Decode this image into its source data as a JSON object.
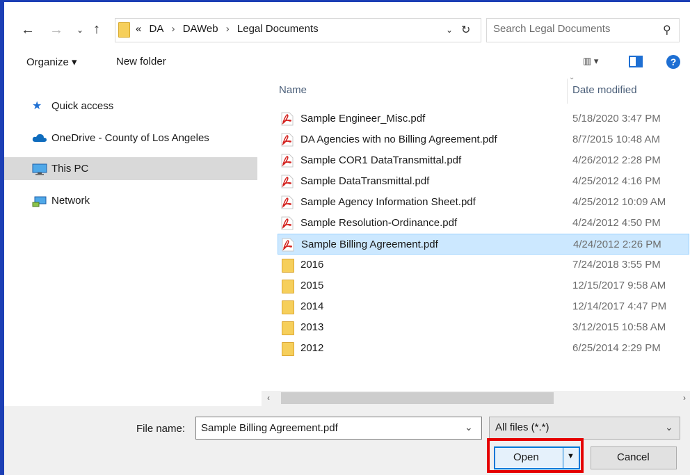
{
  "address_bar": {
    "overflow": "«",
    "crumbs": [
      "DA",
      "DAWeb",
      "Legal Documents"
    ],
    "separator": "›"
  },
  "search": {
    "placeholder": "Search Legal Documents"
  },
  "toolbar": {
    "organize_label": "Organize ▾",
    "new_folder_label": "New folder"
  },
  "nav_pane": {
    "items": [
      {
        "label": "Quick access",
        "icon": "star-icon",
        "selected": false
      },
      {
        "label": "OneDrive - County of Los Angeles",
        "icon": "cloud-icon",
        "selected": false
      },
      {
        "label": "This PC",
        "icon": "monitor-icon",
        "selected": true
      },
      {
        "label": "Network",
        "icon": "network-icon",
        "selected": false
      }
    ]
  },
  "file_list": {
    "columns": {
      "name": "Name",
      "date": "Date modified"
    },
    "rows": [
      {
        "name": "Sample Engineer_Misc.pdf",
        "date": "5/18/2020 3:47 PM",
        "type": "pdf"
      },
      {
        "name": "DA Agencies with no Billing Agreement.pdf",
        "date": "8/7/2015 10:48 AM",
        "type": "pdf"
      },
      {
        "name": "Sample COR1 DataTransmittal.pdf",
        "date": "4/26/2012 2:28 PM",
        "type": "pdf"
      },
      {
        "name": "Sample DataTransmittal.pdf",
        "date": "4/25/2012 4:16 PM",
        "type": "pdf"
      },
      {
        "name": "Sample Agency Information Sheet.pdf",
        "date": "4/25/2012 10:09 AM",
        "type": "pdf"
      },
      {
        "name": "Sample Resolution-Ordinance.pdf",
        "date": "4/24/2012 4:50 PM",
        "type": "pdf"
      },
      {
        "name": "Sample Billing Agreement.pdf",
        "date": "4/24/2012 2:26 PM",
        "type": "pdf",
        "selected": true
      },
      {
        "name": "2016",
        "date": "7/24/2018 3:55 PM",
        "type": "folder"
      },
      {
        "name": "2015",
        "date": "12/15/2017 9:58 AM",
        "type": "folder"
      },
      {
        "name": "2014",
        "date": "12/14/2017 4:47 PM",
        "type": "folder"
      },
      {
        "name": "2013",
        "date": "3/12/2015 10:58 AM",
        "type": "folder"
      },
      {
        "name": "2012",
        "date": "6/25/2014 2:29 PM",
        "type": "folder"
      }
    ]
  },
  "bottom": {
    "file_name_label": "File name:",
    "file_name_value": "Sample Billing Agreement.pdf",
    "file_type_value": "All files (*.*)",
    "open_label": "Open",
    "cancel_label": "Cancel"
  },
  "colors": {
    "selection": "#cce8ff",
    "highlight_box": "#e50000",
    "accent": "#0078d7"
  }
}
